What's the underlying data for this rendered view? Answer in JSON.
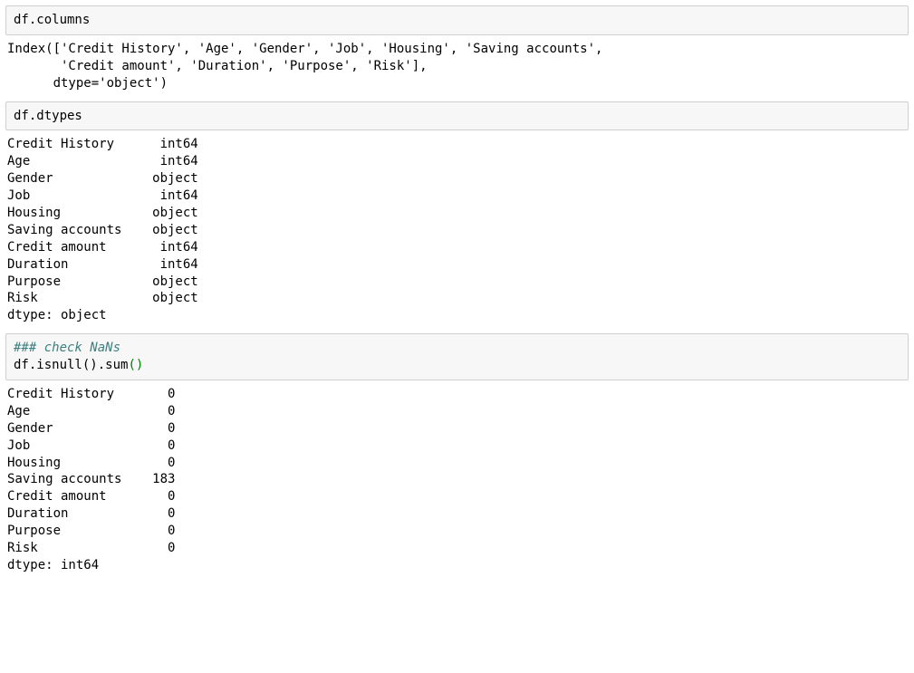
{
  "cells": [
    {
      "input_plain": "df.columns",
      "output": "Index(['Credit History', 'Age', 'Gender', 'Job', 'Housing', 'Saving accounts',\n       'Credit amount', 'Duration', 'Purpose', 'Risk'],\n      dtype='object')"
    },
    {
      "input_plain": "df.dtypes",
      "output": "Credit History      int64\nAge                 int64\nGender             object\nJob                 int64\nHousing            object\nSaving accounts    object\nCredit amount       int64\nDuration            int64\nPurpose            object\nRisk               object\ndtype: object"
    },
    {
      "comment": "### check NaNs",
      "code_prefix": "df.isnull().sum",
      "paren_open": "(",
      "paren_close": ")",
      "output": "Credit History       0\nAge                  0\nGender               0\nJob                  0\nHousing              0\nSaving accounts    183\nCredit amount        0\nDuration             0\nPurpose              0\nRisk                 0\ndtype: int64"
    }
  ]
}
